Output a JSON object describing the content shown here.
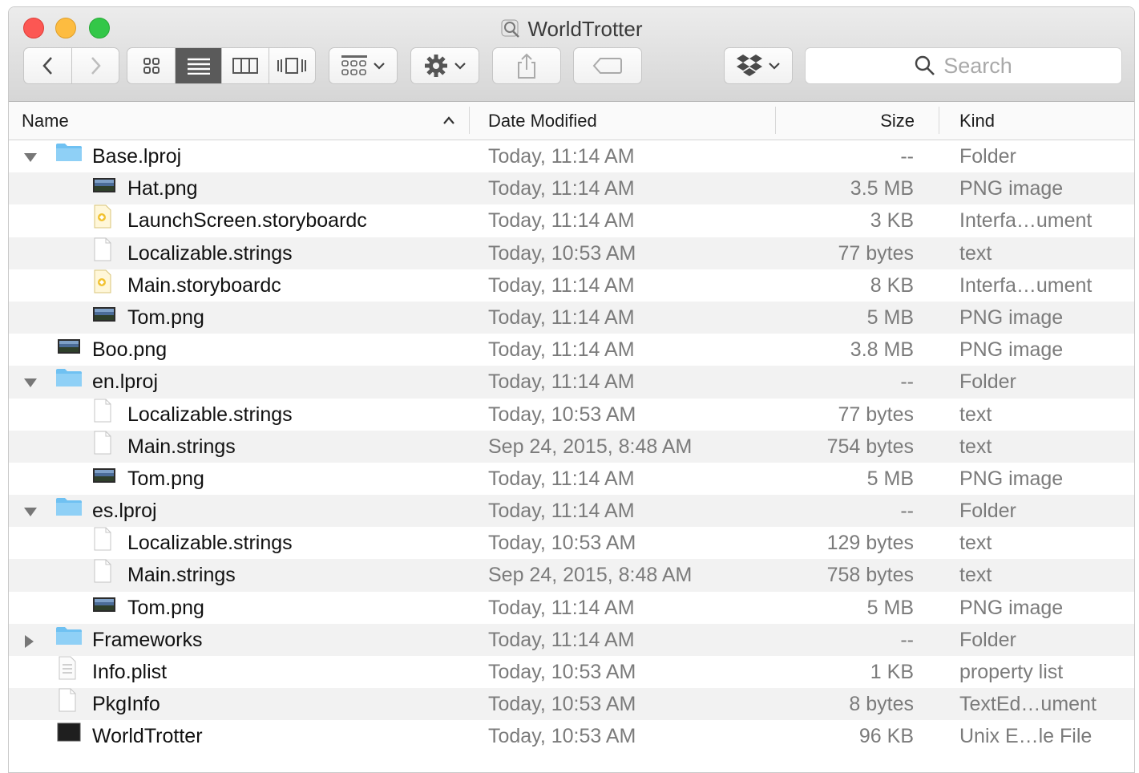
{
  "window": {
    "title": "WorldTrotter"
  },
  "toolbar": {
    "search_placeholder": "Search"
  },
  "columns": {
    "name": "Name",
    "date": "Date Modified",
    "size": "Size",
    "kind": "Kind"
  },
  "rows": [
    {
      "name": "Base.lproj",
      "date": "Today, 11:14 AM",
      "size": "--",
      "kind": "Folder",
      "icon": "folder-icon",
      "level": 0,
      "disclosure": "expanded"
    },
    {
      "name": "Hat.png",
      "date": "Today, 11:14 AM",
      "size": "3.5 MB",
      "kind": "PNG image",
      "icon": "image-file-icon",
      "level": 1,
      "disclosure": "none"
    },
    {
      "name": "LaunchScreen.storyboardc",
      "date": "Today, 11:14 AM",
      "size": "3 KB",
      "kind": "Interfa…ument",
      "icon": "storyboard-file-icon",
      "level": 1,
      "disclosure": "none"
    },
    {
      "name": "Localizable.strings",
      "date": "Today, 10:53 AM",
      "size": "77 bytes",
      "kind": "text",
      "icon": "text-file-icon",
      "level": 1,
      "disclosure": "none"
    },
    {
      "name": "Main.storyboardc",
      "date": "Today, 11:14 AM",
      "size": "8 KB",
      "kind": "Interfa…ument",
      "icon": "storyboard-file-icon",
      "level": 1,
      "disclosure": "none"
    },
    {
      "name": "Tom.png",
      "date": "Today, 11:14 AM",
      "size": "5 MB",
      "kind": "PNG image",
      "icon": "image-file-icon",
      "level": 1,
      "disclosure": "none"
    },
    {
      "name": "Boo.png",
      "date": "Today, 11:14 AM",
      "size": "3.8 MB",
      "kind": "PNG image",
      "icon": "image-file-icon",
      "level": 0,
      "disclosure": "none"
    },
    {
      "name": "en.lproj",
      "date": "Today, 11:14 AM",
      "size": "--",
      "kind": "Folder",
      "icon": "folder-icon",
      "level": 0,
      "disclosure": "expanded"
    },
    {
      "name": "Localizable.strings",
      "date": "Today, 10:53 AM",
      "size": "77 bytes",
      "kind": "text",
      "icon": "text-file-icon",
      "level": 1,
      "disclosure": "none"
    },
    {
      "name": "Main.strings",
      "date": "Sep 24, 2015, 8:48 AM",
      "size": "754 bytes",
      "kind": "text",
      "icon": "text-file-icon",
      "level": 1,
      "disclosure": "none"
    },
    {
      "name": "Tom.png",
      "date": "Today, 11:14 AM",
      "size": "5 MB",
      "kind": "PNG image",
      "icon": "image-file-icon",
      "level": 1,
      "disclosure": "none"
    },
    {
      "name": "es.lproj",
      "date": "Today, 11:14 AM",
      "size": "--",
      "kind": "Folder",
      "icon": "folder-icon",
      "level": 0,
      "disclosure": "expanded"
    },
    {
      "name": "Localizable.strings",
      "date": "Today, 10:53 AM",
      "size": "129 bytes",
      "kind": "text",
      "icon": "text-file-icon",
      "level": 1,
      "disclosure": "none"
    },
    {
      "name": "Main.strings",
      "date": "Sep 24, 2015, 8:48 AM",
      "size": "758 bytes",
      "kind": "text",
      "icon": "text-file-icon",
      "level": 1,
      "disclosure": "none"
    },
    {
      "name": "Tom.png",
      "date": "Today, 11:14 AM",
      "size": "5 MB",
      "kind": "PNG image",
      "icon": "image-file-icon",
      "level": 1,
      "disclosure": "none"
    },
    {
      "name": "Frameworks",
      "date": "Today, 11:14 AM",
      "size": "--",
      "kind": "Folder",
      "icon": "folder-icon",
      "level": 0,
      "disclosure": "collapsed"
    },
    {
      "name": "Info.plist",
      "date": "Today, 10:53 AM",
      "size": "1 KB",
      "kind": "property list",
      "icon": "plist-file-icon",
      "level": 0,
      "disclosure": "none"
    },
    {
      "name": "PkgInfo",
      "date": "Today, 10:53 AM",
      "size": "8 bytes",
      "kind": "TextEd…ument",
      "icon": "text-file-icon",
      "level": 0,
      "disclosure": "none"
    },
    {
      "name": "WorldTrotter",
      "date": "Today, 10:53 AM",
      "size": "96 KB",
      "kind": "Unix E…le File",
      "icon": "executable-file-icon",
      "level": 0,
      "disclosure": "none"
    }
  ],
  "colors": {
    "close": "#fc5753",
    "minimize": "#fdbc40",
    "maximize": "#33c748",
    "folder": "#6fc1f2",
    "stripe": "#f2f2f2"
  }
}
